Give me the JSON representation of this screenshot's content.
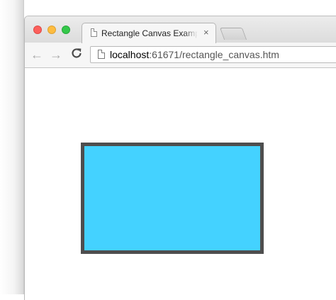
{
  "browser": {
    "tab": {
      "title": "Rectangle Canvas Example",
      "close_glyph": "×"
    },
    "toolbar": {
      "back_glyph": "←",
      "forward_glyph": "→",
      "reload_glyph": "C"
    },
    "address_bar": {
      "host": "localhost",
      "rest": ":61671/rectangle_canvas.htm"
    }
  },
  "canvas": {
    "rect_fill": "#44d2ff",
    "rect_stroke": "#4e4e4e"
  },
  "colors": {
    "close": "#fc605c",
    "minimize": "#fdbc40",
    "zoom": "#34c84a"
  }
}
